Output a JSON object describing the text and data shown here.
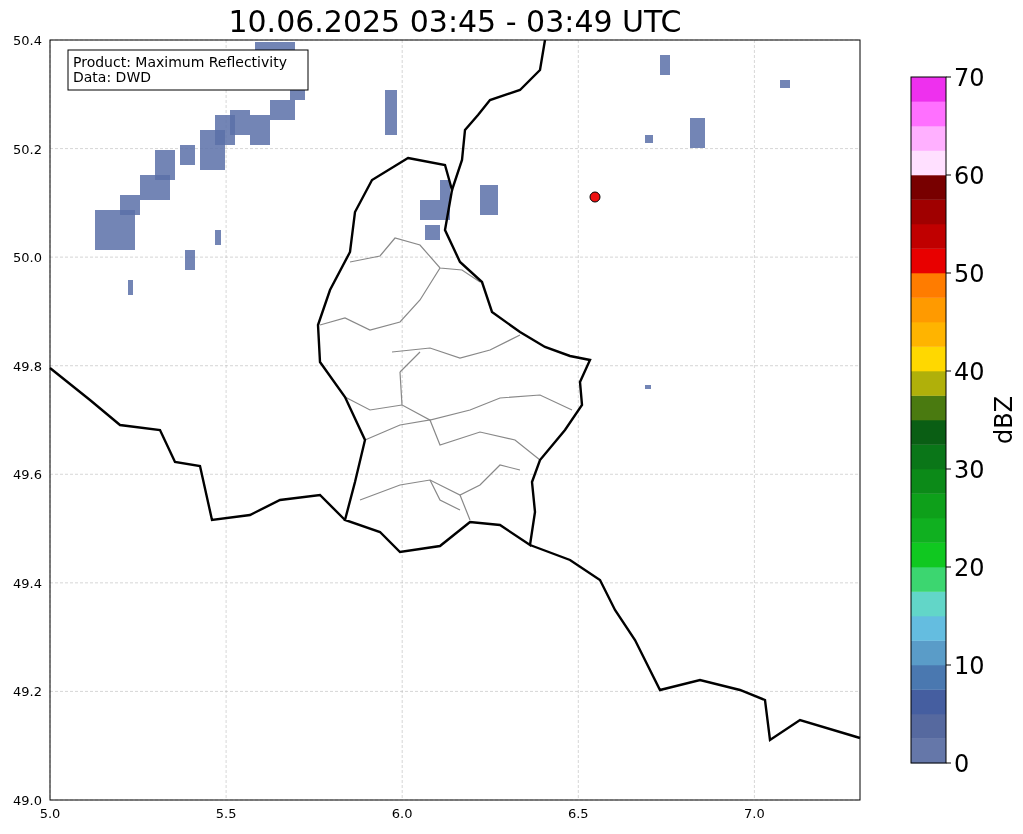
{
  "title": "10.06.2025 03:45 - 03:49 UTC",
  "annotation": {
    "lines": [
      "Product: Maximum Reflectivity",
      "Data: DWD"
    ]
  },
  "map": {
    "xticks": [
      "5.0",
      "5.5",
      "6.0",
      "6.5",
      "7.0"
    ],
    "yticks": [
      "50.4",
      "50.2",
      "50.0",
      "49.8",
      "49.6",
      "49.4",
      "49.2",
      "49.0"
    ]
  },
  "colorbar": {
    "label": "dBZ",
    "ticks": [
      "70",
      "60",
      "50",
      "40",
      "30",
      "20",
      "10",
      "0"
    ],
    "segments": [
      {
        "color": "#6577a9"
      },
      {
        "color": "#56699f"
      },
      {
        "color": "#455ea0"
      },
      {
        "color": "#4a78b0"
      },
      {
        "color": "#5a9cc8"
      },
      {
        "color": "#64bde0"
      },
      {
        "color": "#62d6c8"
      },
      {
        "color": "#3cd670"
      },
      {
        "color": "#10c820"
      },
      {
        "color": "#10b020"
      },
      {
        "color": "#0ea01a"
      },
      {
        "color": "#0c8a18"
      },
      {
        "color": "#0a7618"
      },
      {
        "color": "#0a5e14"
      },
      {
        "color": "#4a7a10"
      },
      {
        "color": "#b0b00a"
      },
      {
        "color": "#ffd800"
      },
      {
        "color": "#ffb400"
      },
      {
        "color": "#ff9a00"
      },
      {
        "color": "#ff7c00"
      },
      {
        "color": "#e80000"
      },
      {
        "color": "#c00000"
      },
      {
        "color": "#a00000"
      },
      {
        "color": "#780000"
      },
      {
        "color": "#ffe0ff"
      },
      {
        "color": "#ffb0ff"
      },
      {
        "color": "#ff70ff"
      },
      {
        "color": "#ee30ee"
      }
    ]
  }
}
